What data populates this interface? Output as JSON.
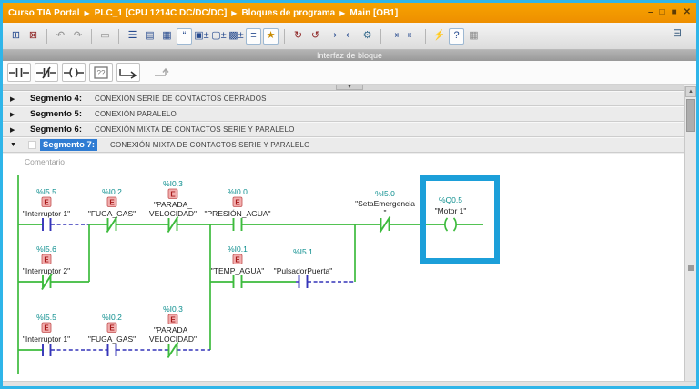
{
  "titlebar": {
    "breadcrumb": [
      "Curso TIA Portal",
      "PLC_1 [CPU 1214C DC/DC/DC]",
      "Bloques de programa",
      "Main [OB1]"
    ],
    "separator": "▶",
    "window_controls": {
      "minimize": "–",
      "float": "□",
      "maximize": "■",
      "close": "✕"
    }
  },
  "toolbar": {
    "icons": [
      {
        "name": "insert-network-icon",
        "glyph": "⊞"
      },
      {
        "name": "delete-network-icon",
        "glyph": "⊠"
      },
      {
        "name": "undo-icon",
        "glyph": "↶"
      },
      {
        "name": "redo-icon",
        "glyph": "↷"
      },
      {
        "name": "select-operand-icon",
        "glyph": "▭"
      },
      {
        "name": "absolute-operands-icon",
        "glyph": "☰"
      },
      {
        "name": "symbolic-operands-icon",
        "glyph": "▤"
      },
      {
        "name": "operand-info-icon",
        "glyph": "▦"
      },
      {
        "name": "network-comments-toggle-icon",
        "glyph": "“"
      },
      {
        "name": "expand-networks-icon",
        "glyph": "▣±"
      },
      {
        "name": "collapse-networks-icon",
        "glyph": "▢±"
      },
      {
        "name": "toggle-networks-icon",
        "glyph": "▩±"
      },
      {
        "name": "status-display-icon",
        "glyph": "≡"
      },
      {
        "name": "favorites-toggle-icon",
        "glyph": "★"
      },
      {
        "name": "update-calls-icon",
        "glyph": "↻"
      },
      {
        "name": "consistency-check-icon",
        "glyph": "↺"
      },
      {
        "name": "next-error-icon",
        "glyph": "⇢"
      },
      {
        "name": "previous-error-icon",
        "glyph": "⇠"
      },
      {
        "name": "settings-icon",
        "glyph": "⚙"
      },
      {
        "name": "jump-forward-icon",
        "glyph": "⇥"
      },
      {
        "name": "jump-back-icon",
        "glyph": "⇤"
      },
      {
        "name": "monitoring-icon",
        "glyph": "⚡"
      },
      {
        "name": "help-query-icon",
        "glyph": "?"
      },
      {
        "name": "compare-icon",
        "glyph": "▦"
      }
    ],
    "right_icon_glyph": "⊟"
  },
  "block_interface_bar": {
    "label": "Interfaz de bloque",
    "handle_glyph": "▾"
  },
  "favorites": {
    "items": [
      "no-contact",
      "nc-contact",
      "coil",
      "empty-box",
      "open-branch",
      "close-branch"
    ]
  },
  "segments": [
    {
      "arrow": "▶",
      "number_label": "Segmento 4:",
      "description": "CONEXIÓN SERIE DE CONTACTOS CERRADOS",
      "selected": false
    },
    {
      "arrow": "▶",
      "number_label": "Segmento 5:",
      "description": "CONEXIÓN PARALELO",
      "selected": false
    },
    {
      "arrow": "▶",
      "number_label": "Segmento 6:",
      "description": "CONEXIÓN MIXTA DE CONTACTOS SERIE Y PARALELO",
      "selected": false
    },
    {
      "arrow": "▼",
      "number_label": "Segmento 7:",
      "description": "CONEXIÓN MIXTA DE CONTACTOS SERIE Y PARALELO",
      "selected": true
    }
  ],
  "comment": {
    "label": "Comentario"
  },
  "ladder": {
    "e_label": "E",
    "colors": {
      "wire": "#3DBB3D",
      "open_branch": "#3434B8",
      "address": "#0C8E8E",
      "highlight": "#1C9FD9"
    },
    "tags": {
      "c1": {
        "address": "%I5.5",
        "name": "\"Interruptor 1\""
      },
      "c2": {
        "address": "%I0.2",
        "name": "\"FUGA_GAS\""
      },
      "c3": {
        "address": "%I0.3",
        "name_line1": "\"PARADA_",
        "name_line2": "VELOCIDAD\""
      },
      "c4": {
        "address": "%I0.0",
        "name": "\"PRESIÓN_AGUA\""
      },
      "c5": {
        "address": "%I5.0",
        "name_line1": "\"SetaEmergencia",
        "name_line2": "\""
      },
      "coil": {
        "address": "%Q0.5",
        "name": "\"Motor 1\""
      },
      "a1": {
        "address": "%I5.6",
        "name": "\"Interruptor 2\""
      },
      "b1": {
        "address": "%I0.1",
        "name": "\"TEMP_AGUA\""
      },
      "b2": {
        "address": "%I5.1",
        "name": "\"PulsadorPuerta\""
      },
      "d1": {
        "address": "%I5.5",
        "name": "\"Interruptor 1\""
      },
      "d2": {
        "address": "%I0.2",
        "name": "\"FUGA_GAS\""
      },
      "d3": {
        "address": "%I0.3",
        "name_line1": "\"PARADA_",
        "name_line2": "VELOCIDAD\""
      }
    }
  },
  "scrollbar": {
    "up_glyph": "▲"
  }
}
